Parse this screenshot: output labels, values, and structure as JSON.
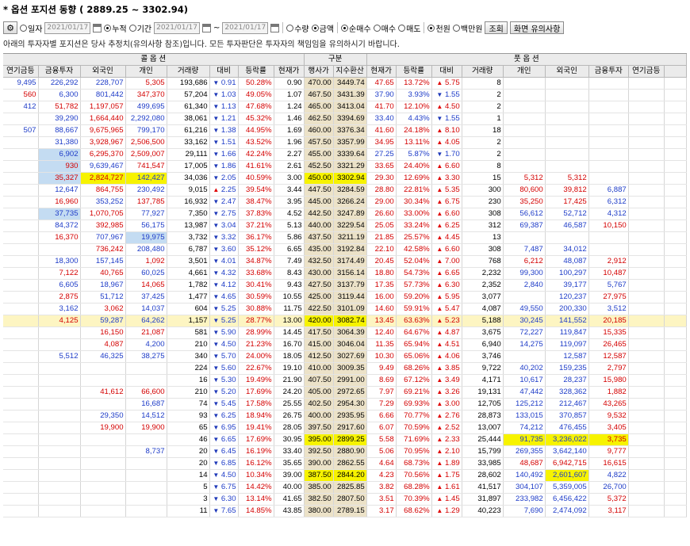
{
  "title": "* 옵션 포지션 동향 ( 2889.25 ~ 3302.94)",
  "toolbar": {
    "gear_icon": "gear-icon",
    "radio_day": "일자",
    "date_single": "2021/01/17",
    "radio_cumulative": "누적",
    "radio_period": "기간",
    "date_from": "2021/01/17",
    "date_tilde": "~",
    "date_to": "2021/01/17",
    "radio_qty": "수량",
    "radio_amount": "금액",
    "radio_netbuy": "순매수",
    "radio_buy": "매수",
    "radio_sell": "매도",
    "radio_won": "천원",
    "radio_million": "백만원",
    "query_button": "조회",
    "notes_button": "화면 유의사항"
  },
  "notice": "아래의 투자자별 포지션은 당사 추정치(유의사항 참조)입니다. 모든 투자판단은 투자자의 책임임을 유의하시기 바랍니다.",
  "colors": {
    "up": "#d40000",
    "down": "#1e3cc8",
    "highlight": "#f7f300",
    "row_highlight": "#fdf5c2",
    "blue_cell": "#c4dcf2",
    "center_col": "#ece2c8"
  },
  "header": {
    "call_group": "콜 옵 션",
    "center_group": "구분",
    "put_group": "풋 옵 션",
    "columns": [
      "연기금등",
      "금융투자",
      "외국인",
      "개인",
      "거래량",
      "대비",
      "등락률",
      "현재가",
      "행사가",
      "지수환산",
      "현재가",
      "등락률",
      "대비",
      "거래량",
      "개인",
      "외국인",
      "금융투자",
      "연기금등"
    ]
  },
  "rows": [
    {
      "cells": [
        "9,495",
        "226,292",
        "228,707",
        "5,305",
        "193,686",
        "0.91",
        "50.28%",
        "0.90",
        "470.00",
        "3449.74",
        "47.65",
        "13.72%",
        "5.75",
        "8",
        "",
        "",
        "",
        ""
      ],
      "c": "bbbrkbrkkkrrrkkkkk",
      "a": [
        "d",
        "u"
      ]
    },
    {
      "cells": [
        "560",
        "6,300",
        "801,442",
        "347,370",
        "57,204",
        "1.03",
        "49.05%",
        "1.07",
        "467.50",
        "3431.39",
        "37.90",
        "3.93%",
        "1.55",
        "2",
        "",
        "",
        "",
        ""
      ],
      "c": "rbbrkbrkkkbbbkkkkk",
      "a": [
        "d",
        "d"
      ]
    },
    {
      "cells": [
        "412",
        "51,782",
        "1,197,057",
        "499,695",
        "61,340",
        "1.13",
        "47.68%",
        "1.24",
        "465.00",
        "3413.04",
        "41.70",
        "12.10%",
        "4.50",
        "2",
        "",
        "",
        "",
        ""
      ],
      "c": "brrbkbrkkkrrrkkkkk",
      "a": [
        "d",
        "u"
      ]
    },
    {
      "cells": [
        "",
        "39,290",
        "1,664,440",
        "2,292,080",
        "38,061",
        "1.21",
        "45.32%",
        "1.46",
        "462.50",
        "3394.69",
        "33.40",
        "4.43%",
        "1.55",
        "1",
        "",
        "",
        "",
        ""
      ],
      "c": "kbrbkbrkkkbbbkkkkk",
      "a": [
        "d",
        "d"
      ]
    },
    {
      "cells": [
        "507",
        "88,667",
        "9,675,965",
        "799,170",
        "61,216",
        "1.38",
        "44.95%",
        "1.69",
        "460.00",
        "3376.34",
        "41.60",
        "24.18%",
        "8.10",
        "18",
        "",
        "",
        "",
        ""
      ],
      "c": "bbrbkbrkkkrrrkkkkk",
      "a": [
        "d",
        "u"
      ]
    },
    {
      "cells": [
        "",
        "31,380",
        "3,928,967",
        "2,506,500",
        "33,162",
        "1.51",
        "43.52%",
        "1.96",
        "457.50",
        "3357.99",
        "34.95",
        "13.11%",
        "4.05",
        "2",
        "",
        "",
        "",
        ""
      ],
      "c": "kbrrkbrkkkrrrkkkkk",
      "a": [
        "d",
        "u"
      ]
    },
    {
      "cells": [
        "",
        "6,902",
        "6,295,370",
        "2,509,007",
        "29,111",
        "1.66",
        "42.24%",
        "2.27",
        "455.00",
        "3339.64",
        "27.25",
        "5.87%",
        "1.70",
        "2",
        "",
        "",
        "",
        ""
      ],
      "c": "kbrrkbrkkkbbbkkkkk",
      "a": [
        "d",
        "d"
      ],
      "bg": {
        "1": "bluebg"
      }
    },
    {
      "cells": [
        "",
        "930",
        "9,639,467",
        "741,547",
        "17,005",
        "1.86",
        "41.61%",
        "2.61",
        "452.50",
        "3321.29",
        "33.65",
        "24.40%",
        "6.60",
        "8",
        "",
        "",
        "",
        ""
      ],
      "c": "krbrkbrkkkrrrkkkkk",
      "a": [
        "d",
        "u"
      ],
      "bg": {
        "1": "bluebg"
      }
    },
    {
      "cells": [
        "",
        "35,327",
        "2,824,727",
        "142,427",
        "34,036",
        "2.05",
        "40.59%",
        "3.00",
        "450.00",
        "3302.94",
        "29.30",
        "12.69%",
        "3.30",
        "15",
        "5,312",
        "5,312",
        "",
        ""
      ],
      "c": "krrbkbrkkkrrrkrrkk",
      "a": [
        "d",
        "u"
      ],
      "bg": {
        "1": "bluebg"
      },
      "hl": [
        1,
        2,
        3,
        8,
        9
      ]
    },
    {
      "cells": [
        "",
        "12,647",
        "864,755",
        "230,492",
        "9,015",
        "2.25",
        "39.54%",
        "3.44",
        "447.50",
        "3284.59",
        "28.80",
        "22.81%",
        "5.35",
        "300",
        "80,600",
        "39,812",
        "6,887",
        ""
      ],
      "c": "kbrbkbrkkkrrrkrrbk",
      "a": [
        "u",
        "u"
      ]
    },
    {
      "cells": [
        "",
        "16,960",
        "353,252",
        "137,785",
        "16,932",
        "2.47",
        "38.47%",
        "3.95",
        "445.00",
        "3266.24",
        "29.00",
        "30.34%",
        "6.75",
        "230",
        "35,250",
        "17,425",
        "6,312",
        ""
      ],
      "c": "krbrkbrkkkrrrkrrbk",
      "a": [
        "d",
        "u"
      ]
    },
    {
      "cells": [
        "",
        "37,735",
        "1,070,705",
        "77,927",
        "7,350",
        "2.75",
        "37.83%",
        "4.52",
        "442.50",
        "3247.89",
        "26.60",
        "33.00%",
        "6.60",
        "308",
        "56,612",
        "52,712",
        "4,312",
        ""
      ],
      "c": "kbrbkbrkkkrrrkbbbk",
      "a": [
        "d",
        "u"
      ],
      "bg": {
        "1": "bluebg"
      }
    },
    {
      "cells": [
        "",
        "84,372",
        "392,985",
        "56,175",
        "13,987",
        "3.04",
        "37.21%",
        "5.13",
        "440.00",
        "3229.54",
        "25.05",
        "33.24%",
        "6.25",
        "312",
        "69,387",
        "46,587",
        "10,150",
        ""
      ],
      "c": "kbrbkbrkkkrrrkbbrk",
      "a": [
        "d",
        "u"
      ]
    },
    {
      "cells": [
        "",
        "16,370",
        "707,967",
        "19,975",
        "3,732",
        "3.32",
        "36.17%",
        "5.86",
        "437.50",
        "3211.19",
        "21.85",
        "25.57%",
        "4.45",
        "13",
        "",
        "",
        "",
        ""
      ],
      "c": "krbbkbrkkkrrrkkkkk",
      "a": [
        "d",
        "u"
      ],
      "bg": {
        "3": "bluebg"
      }
    },
    {
      "cells": [
        "",
        "",
        "736,242",
        "208,480",
        "6,787",
        "3.60",
        "35.12%",
        "6.65",
        "435.00",
        "3192.84",
        "22.10",
        "42.58%",
        "6.60",
        "308",
        "7,487",
        "34,012",
        "",
        ""
      ],
      "c": "kkrbkbrkkkrrrkbbkk",
      "a": [
        "d",
        "u"
      ]
    },
    {
      "cells": [
        "",
        "18,300",
        "157,145",
        "1,092",
        "3,501",
        "4.01",
        "34.87%",
        "7.49",
        "432.50",
        "3174.49",
        "20.45",
        "52.04%",
        "7.00",
        "768",
        "6,212",
        "48,087",
        "2,912",
        ""
      ],
      "c": "kbbrkbrkkkrrrkrbrk",
      "a": [
        "d",
        "u"
      ]
    },
    {
      "cells": [
        "",
        "7,122",
        "40,765",
        "60,025",
        "4,661",
        "4.32",
        "33.68%",
        "8.43",
        "430.00",
        "3156.14",
        "18.80",
        "54.73%",
        "6.65",
        "2,232",
        "99,300",
        "100,297",
        "10,487",
        ""
      ],
      "c": "krrbkbrkkkrrrkbbrk",
      "a": [
        "d",
        "u"
      ]
    },
    {
      "cells": [
        "",
        "6,605",
        "18,967",
        "14,065",
        "1,782",
        "4.12",
        "30.41%",
        "9.43",
        "427.50",
        "3137.79",
        "17.35",
        "57.73%",
        "6.30",
        "2,352",
        "2,840",
        "39,177",
        "5,767",
        ""
      ],
      "c": "kbbrkbrkkkrrrkbbbk",
      "a": [
        "d",
        "u"
      ]
    },
    {
      "cells": [
        "",
        "2,875",
        "51,712",
        "37,425",
        "1,477",
        "4.65",
        "30.59%",
        "10.55",
        "425.00",
        "3119.44",
        "16.00",
        "59.20%",
        "5.95",
        "3,077",
        "",
        "120,237",
        "27,975",
        ""
      ],
      "c": "krbbkbrkkkrrrkkbrk",
      "a": [
        "d",
        "u"
      ]
    },
    {
      "cells": [
        "",
        "3,162",
        "3,062",
        "14,037",
        "604",
        "5.25",
        "30.88%",
        "11.75",
        "422.50",
        "3101.09",
        "14.60",
        "59.91%",
        "5.47",
        "4,087",
        "49,550",
        "200,330",
        "3,512",
        ""
      ],
      "c": "kbrbkbrkkkrrrkbbbk",
      "a": [
        "d",
        "u"
      ]
    },
    {
      "cells": [
        "",
        "4,125",
        "59,287",
        "64,262",
        "1,157",
        "5.25",
        "28.77%",
        "13.00",
        "420.00",
        "3082.74",
        "13.45",
        "63.63%",
        "5.23",
        "5,188",
        "30,245",
        "141,552",
        "20,185",
        ""
      ],
      "c": "krbbkbrkkkrrrkbbrk",
      "a": [
        "d",
        "u"
      ],
      "rowhl": true,
      "hl": [
        8,
        9
      ]
    },
    {
      "cells": [
        "",
        "",
        "16,150",
        "21,087",
        "581",
        "5.90",
        "28.99%",
        "14.45",
        "417.50",
        "3064.39",
        "12.40",
        "64.67%",
        "4.87",
        "3,675",
        "72,227",
        "119,847",
        "15,335",
        ""
      ],
      "c": "kkrrkbrkkkrrrkbbrk",
      "a": [
        "d",
        "u"
      ]
    },
    {
      "cells": [
        "",
        "",
        "4,087",
        "4,200",
        "210",
        "4.50",
        "21.23%",
        "16.70",
        "415.00",
        "3046.04",
        "11.35",
        "65.94%",
        "4.51",
        "6,940",
        "14,275",
        "119,097",
        "26,465",
        ""
      ],
      "c": "kkrbkbrkkkrrrkbbrk",
      "a": [
        "d",
        "u"
      ]
    },
    {
      "cells": [
        "",
        "5,512",
        "46,325",
        "38,275",
        "340",
        "5.70",
        "24.00%",
        "18.05",
        "412.50",
        "3027.69",
        "10.30",
        "65.06%",
        "4.06",
        "3,746",
        "",
        "12,587",
        "12,587",
        ""
      ],
      "c": "kbbbkbrkkkrrrkkbrk",
      "a": [
        "d",
        "u"
      ]
    },
    {
      "cells": [
        "",
        "",
        "",
        "",
        "224",
        "5.60",
        "22.67%",
        "19.10",
        "410.00",
        "3009.35",
        "9.49",
        "68.26%",
        "3.85",
        "9,722",
        "40,202",
        "159,235",
        "2,797",
        ""
      ],
      "c": "kkkkkbrkkkrrrkbbrk",
      "a": [
        "d",
        "u"
      ]
    },
    {
      "cells": [
        "",
        "",
        "",
        "",
        "16",
        "5.30",
        "19.49%",
        "21.90",
        "407.50",
        "2991.00",
        "8.69",
        "67.12%",
        "3.49",
        "4,171",
        "10,617",
        "28,237",
        "15,980",
        ""
      ],
      "c": "kkkkkbrkkkrrrkbbrk",
      "a": [
        "d",
        "u"
      ]
    },
    {
      "cells": [
        "",
        "",
        "41,612",
        "66,600",
        "210",
        "5.20",
        "17.69%",
        "24.20",
        "405.00",
        "2972.65",
        "7.97",
        "69.21%",
        "3.26",
        "19,131",
        "47,442",
        "328,362",
        "1,882",
        ""
      ],
      "c": "kkrrkbrkkkrrrkbbrk",
      "a": [
        "d",
        "u"
      ]
    },
    {
      "cells": [
        "",
        "",
        "",
        "16,687",
        "74",
        "5.45",
        "17.58%",
        "25.55",
        "402.50",
        "2954.30",
        "7.29",
        "69.93%",
        "3.00",
        "12,705",
        "125,212",
        "212,467",
        "43,265",
        ""
      ],
      "c": "kkkbkbrkkkrrrkbbrk",
      "a": [
        "d",
        "u"
      ]
    },
    {
      "cells": [
        "",
        "",
        "29,350",
        "14,512",
        "93",
        "6.25",
        "18.94%",
        "26.75",
        "400.00",
        "2935.95",
        "6.66",
        "70.77%",
        "2.76",
        "28,873",
        "133,015",
        "370,857",
        "9,532",
        ""
      ],
      "c": "kkbbkbrkkkrrrkbbrk",
      "a": [
        "d",
        "u"
      ]
    },
    {
      "cells": [
        "",
        "",
        "19,900",
        "19,900",
        "65",
        "6.95",
        "19.41%",
        "28.05",
        "397.50",
        "2917.60",
        "6.07",
        "70.59%",
        "2.52",
        "13,007",
        "74,212",
        "476,455",
        "3,405",
        ""
      ],
      "c": "kkrrkbrkkkrrrkbbrk",
      "a": [
        "d",
        "u"
      ]
    },
    {
      "cells": [
        "",
        "",
        "",
        "",
        "46",
        "6.65",
        "17.69%",
        "30.95",
        "395.00",
        "2899.25",
        "5.58",
        "71.69%",
        "2.33",
        "25,444",
        "91,735",
        "3,236,022",
        "3,735",
        ""
      ],
      "c": "kkkkkbrkkkrrrkbbrk",
      "a": [
        "d",
        "u"
      ],
      "hl": [
        8,
        9,
        14,
        15,
        16
      ]
    },
    {
      "cells": [
        "",
        "",
        "",
        "8,737",
        "20",
        "6.45",
        "16.19%",
        "33.40",
        "392.50",
        "2880.90",
        "5.06",
        "70.95%",
        "2.10",
        "15,799",
        "269,355",
        "3,642,140",
        "9,777",
        ""
      ],
      "c": "kkkbkbrkkkrrrkbbrk",
      "a": [
        "d",
        "u"
      ]
    },
    {
      "cells": [
        "",
        "",
        "",
        "",
        "20",
        "6.85",
        "16.12%",
        "35.65",
        "390.00",
        "2862.55",
        "4.64",
        "68.73%",
        "1.89",
        "33,985",
        "48,687",
        "6,942,715",
        "16,615",
        ""
      ],
      "c": "kkkkkbrkkkrrrkrrrk",
      "a": [
        "d",
        "u"
      ]
    },
    {
      "cells": [
        "",
        "",
        "",
        "",
        "14",
        "4.50",
        "10.34%",
        "39.00",
        "387.50",
        "2844.20",
        "4.23",
        "70.56%",
        "1.75",
        "28,602",
        "140,492",
        "2,601,607",
        "4,822",
        ""
      ],
      "c": "kkkkkbrkkkrrrkbbbk",
      "a": [
        "d",
        "u"
      ],
      "hl": [
        8,
        9,
        15
      ]
    },
    {
      "cells": [
        "",
        "",
        "",
        "",
        "5",
        "6.75",
        "14.42%",
        "40.00",
        "385.00",
        "2825.85",
        "3.82",
        "68.28%",
        "1.61",
        "41,517",
        "304,107",
        "5,359,005",
        "26,700",
        ""
      ],
      "c": "kkkkkbrkkkrrrkbbbk",
      "a": [
        "d",
        "u"
      ]
    },
    {
      "cells": [
        "",
        "",
        "",
        "",
        "3",
        "6.30",
        "13.14%",
        "41.65",
        "382.50",
        "2807.50",
        "3.51",
        "70.39%",
        "1.45",
        "31,897",
        "233,982",
        "6,456,422",
        "5,372",
        ""
      ],
      "c": "kkkkkbrkkkrrrkbbrk",
      "a": [
        "d",
        "u"
      ]
    },
    {
      "cells": [
        "",
        "",
        "",
        "",
        "11",
        "7.65",
        "14.85%",
        "43.85",
        "380.00",
        "2789.15",
        "3.17",
        "68.62%",
        "1.29",
        "40,223",
        "7,690",
        "2,474,092",
        "3,117",
        ""
      ],
      "c": "kkkkkbrkkkrrrkbbrk",
      "a": [
        "d",
        "u"
      ]
    }
  ]
}
